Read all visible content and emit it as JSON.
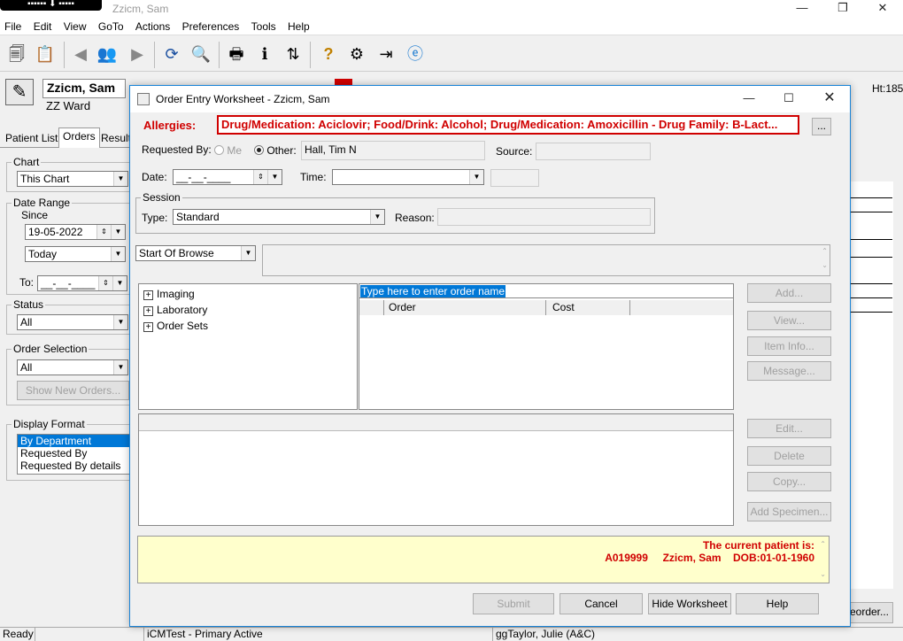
{
  "app": {
    "title": "Zzicm, Sam"
  },
  "menu": [
    "File",
    "Edit",
    "View",
    "GoTo",
    "Actions",
    "Preferences",
    "Tools",
    "Help"
  ],
  "window_controls": {
    "minimize": "—",
    "restore": "❐",
    "close": "✕"
  },
  "patient": {
    "name": "Zzicm, Sam",
    "ward": "ZZ Ward",
    "partial_ht": "Ht:185"
  },
  "left_tabs": [
    "Patient List",
    "Orders",
    "Results"
  ],
  "chart": {
    "label": "Chart",
    "value": "This Chart"
  },
  "date_range": {
    "label": "Date Range",
    "since_label": "Since",
    "since_value": "19-05-2022",
    "period": "Today",
    "to_label": "To:",
    "to_value": "__-__-____"
  },
  "status": {
    "label": "Status",
    "value": "All"
  },
  "order_selection": {
    "label": "Order Selection",
    "value": "All",
    "show_new": "Show New Orders..."
  },
  "display_format": {
    "label": "Display Format",
    "items": [
      "By Department",
      "Requested By",
      "Requested By details"
    ],
    "selected": 0
  },
  "right_partial_button": "eorder...",
  "statusbar": {
    "ready": "Ready",
    "db": "iCMTest - Primary Active",
    "user": "ggTaylor, Julie  (A&C)"
  },
  "dialog": {
    "title": "Order Entry Worksheet - Zzicm, Sam",
    "allergies_label": "Allergies:",
    "allergies_text": "Drug/Medication: Aciclovir; Food/Drink: Alcohol; Drug/Medication: Amoxicillin - Drug Family: B-Lact...",
    "ellipsis_button": "...",
    "requested_by_label": "Requested By:",
    "me_label": "Me",
    "other_label": "Other:",
    "other_value": "Hall, Tim N",
    "source_label": "Source:",
    "date_label": "Date:",
    "date_value": "__-__-____",
    "time_label": "Time:",
    "session_label": "Session",
    "type_label": "Type:",
    "type_value": "Standard",
    "reason_label": "Reason:",
    "browse_value": "Start Of Browse",
    "tree": [
      "Imaging",
      "Laboratory",
      "Order Sets"
    ],
    "search_placeholder": "Type here to enter order name",
    "columns": [
      "Order",
      "Cost"
    ],
    "buttons_top": [
      "Add...",
      "View...",
      "Item Info...",
      "Message..."
    ],
    "buttons_mid": [
      "Edit...",
      "Delete",
      "Copy...",
      "Add Specimen..."
    ],
    "patient_notice": {
      "line1": "The current patient is:",
      "id": "A019999",
      "name": "Zzicm, Sam",
      "dob": "DOB:01-01-1960"
    },
    "footer_buttons": [
      "Submit",
      "Cancel",
      "Hide Worksheet",
      "Help"
    ]
  }
}
